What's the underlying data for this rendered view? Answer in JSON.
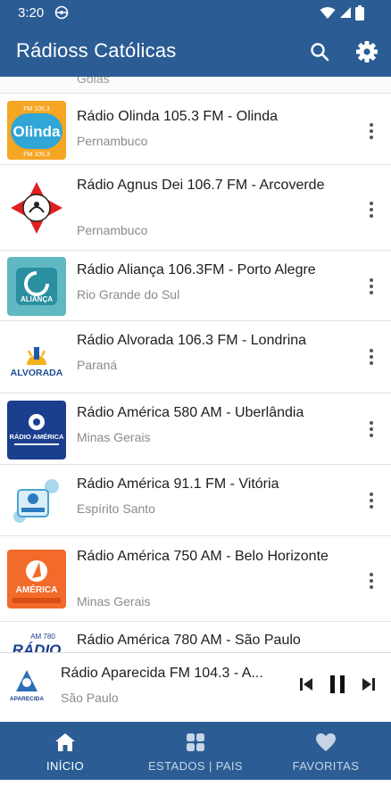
{
  "status_bar": {
    "time": "3:20"
  },
  "app_bar": {
    "title": "Rádioss Católicas",
    "search_icon": "search-icon",
    "settings_icon": "gear-icon"
  },
  "colors": {
    "primary": "#2b5d94",
    "text": "#1d1d1d",
    "secondary_text": "#8b8b8b"
  },
  "list": {
    "partial_top_region": "Goiás",
    "items": [
      {
        "name": "Rádio Olinda 105.3 FM - Olinda",
        "region": "Pernambuco",
        "logo_text": "Olinda",
        "logo_sub": "FM 105,3"
      },
      {
        "name": "Rádio Agnus Dei 106.7 FM - Arcoverde",
        "region": "Pernambuco",
        "logo_text": "",
        "logo_sub": ""
      },
      {
        "name": "Rádio Aliança 106.3FM - Porto Alegre",
        "region": "Rio Grande do Sul",
        "logo_text": "ALIANÇA",
        "logo_sub": ""
      },
      {
        "name": "Rádio Alvorada 106.3 FM - Londrina",
        "region": "Paraná",
        "logo_text": "ALVORADA",
        "logo_sub": ""
      },
      {
        "name": "Rádio América 580 AM - Uberlândia",
        "region": "Minas Gerais",
        "logo_text": "RÁDIO AMÉRICA",
        "logo_sub": ""
      },
      {
        "name": "Rádio América 91.1 FM - Vitória",
        "region": "Espírito Santo",
        "logo_text": "",
        "logo_sub": ""
      },
      {
        "name": "Rádio América 750 AM - Belo Horizonte",
        "region": "Minas Gerais",
        "logo_text": "AMÉRICA",
        "logo_sub": ""
      },
      {
        "name": "Rádio América 780 AM - São Paulo",
        "region": "",
        "logo_text": "RÁDIO",
        "logo_sub": "AM 780"
      }
    ]
  },
  "player": {
    "name": "Rádio Aparecida FM 104.3 - A...",
    "region": "São Paulo",
    "logo_text": "APARECIDA"
  },
  "bottom_nav": [
    {
      "label": "INÍCIO",
      "icon": "home-icon",
      "active": true
    },
    {
      "label": "ESTADOS | PAIS",
      "icon": "grid-icon",
      "active": false
    },
    {
      "label": "FAVORITAS",
      "icon": "heart-icon",
      "active": false
    }
  ]
}
